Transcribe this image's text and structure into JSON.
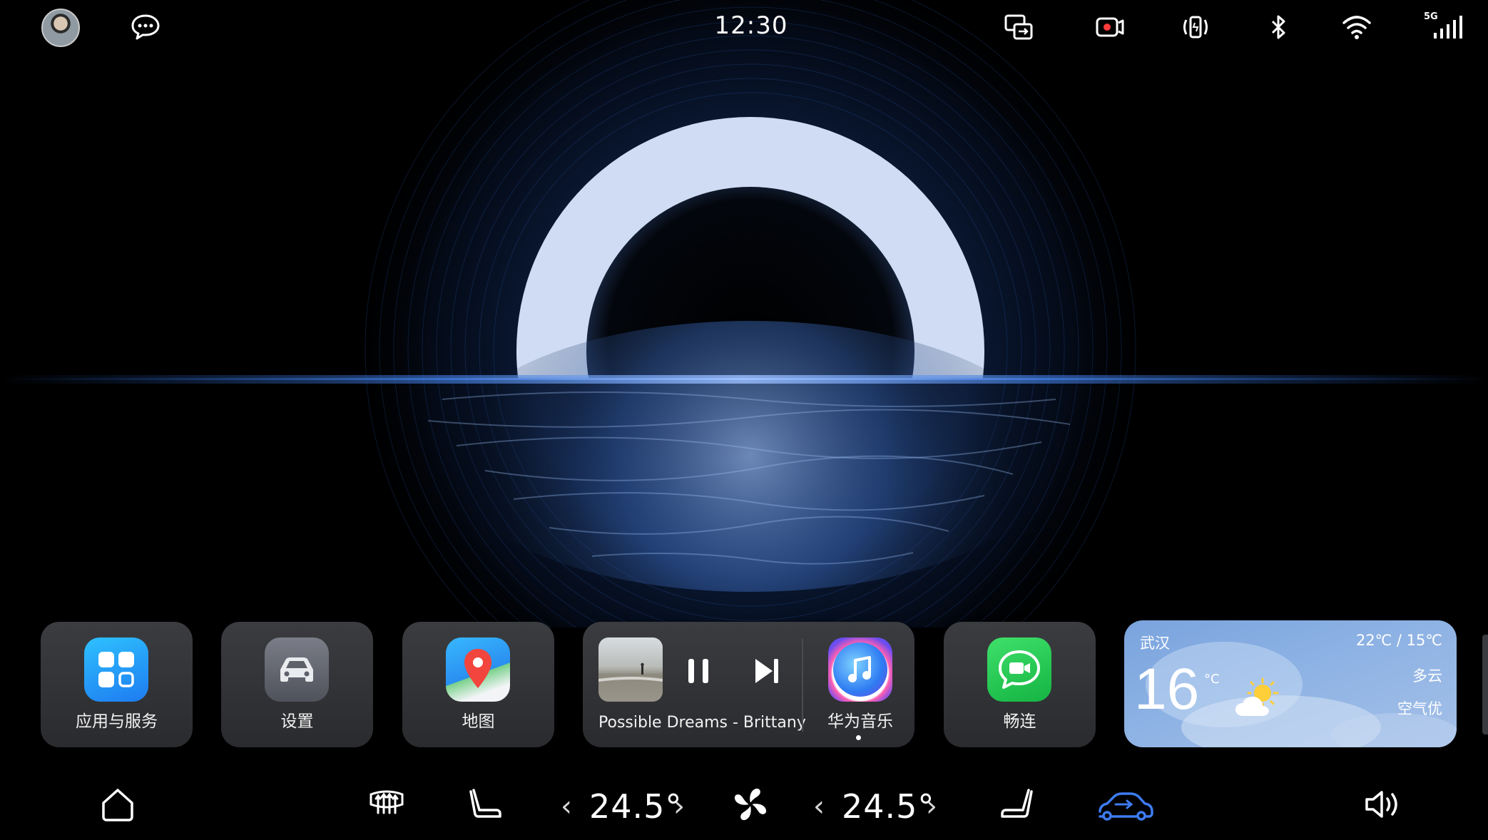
{
  "status_bar": {
    "time": "12:30",
    "network_label": "5G",
    "icons": [
      "avatar",
      "chat-bubble-icon",
      "screen-projection-icon",
      "dashcam-record-icon",
      "nfc-vibrate-icon",
      "bluetooth-icon",
      "wifi-icon",
      "cellular-5g-icon"
    ]
  },
  "dock": {
    "apps": [
      {
        "label": "应用与服务"
      },
      {
        "label": "设置"
      },
      {
        "label": "地图"
      }
    ],
    "music": {
      "song": "Possible Dreams - Brittany",
      "app_label": "华为音乐",
      "state": "playing"
    },
    "changlian": {
      "label": "畅连"
    },
    "weather": {
      "city": "武汉",
      "temp": "16",
      "unit": "°C",
      "range": "22℃ / 15℃",
      "condition": "多云",
      "air": "空气优"
    }
  },
  "climate": {
    "left_temp": "24.5°",
    "right_temp": "24.5°",
    "chev_left": "‹",
    "chev_right": "›"
  },
  "colors": {
    "accent_blue": "#3d7bf0",
    "wallpaper_glow": "#cfdcf3"
  }
}
